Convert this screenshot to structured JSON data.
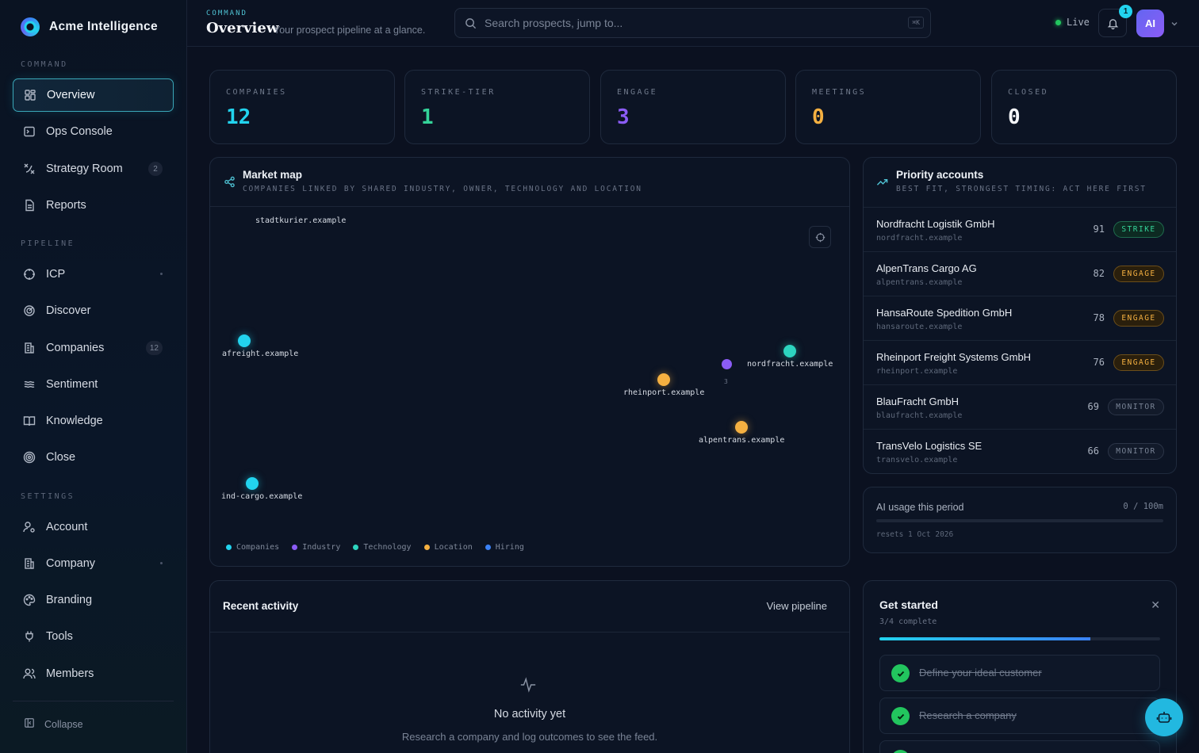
{
  "app": {
    "name": "Acme Intelligence"
  },
  "sidebar": {
    "sections": {
      "command": "COMMAND",
      "pipeline": "PIPELINE",
      "settings": "SETTINGS"
    },
    "items": [
      {
        "label": "Overview",
        "icon": "grid-icon",
        "active": true
      },
      {
        "label": "Ops Console",
        "icon": "terminal-icon"
      },
      {
        "label": "Strategy Room",
        "icon": "strategy-icon",
        "badge": "2"
      },
      {
        "label": "Reports",
        "icon": "document-icon"
      },
      {
        "label": "ICP",
        "icon": "target-icon"
      },
      {
        "label": "Discover",
        "icon": "radar-icon"
      },
      {
        "label": "Companies",
        "icon": "building-icon",
        "badge": "12"
      },
      {
        "label": "Sentiment",
        "icon": "waves-icon"
      },
      {
        "label": "Knowledge",
        "icon": "book-icon"
      },
      {
        "label": "Close",
        "icon": "bullseye-icon"
      },
      {
        "label": "Account",
        "icon": "user-gear-icon"
      },
      {
        "label": "Company",
        "icon": "building-icon"
      },
      {
        "label": "Branding",
        "icon": "palette-icon"
      },
      {
        "label": "Tools",
        "icon": "plug-icon"
      },
      {
        "label": "Members",
        "icon": "users-icon"
      }
    ],
    "collapse_label": "Collapse"
  },
  "header": {
    "crumb": "COMMAND",
    "title": "Overview",
    "subtitle": "Your prospect pipeline at a glance.",
    "search_placeholder": "Search prospects, jump to...",
    "shortcut": "⌘K",
    "live_label": "Live",
    "notification_count": "1",
    "avatar_initials": "AI"
  },
  "stats": [
    {
      "label": "COMPANIES",
      "value": "12",
      "color": "#22d3ee"
    },
    {
      "label": "STRIKE-TIER",
      "value": "1",
      "color": "#34d399"
    },
    {
      "label": "ENGAGE",
      "value": "3",
      "color": "#8b5cf6"
    },
    {
      "label": "MEETINGS",
      "value": "0",
      "color": "#f5b041"
    },
    {
      "label": "CLOSED",
      "value": "0",
      "color": "#f4f6fa"
    }
  ],
  "market_map": {
    "title": "Market map",
    "subtitle": "COMPANIES LINKED BY SHARED INDUSTRY, OWNER, TECHNOLOGY AND LOCATION",
    "nodes": [
      {
        "label": "stadtkurier.example",
        "type": "Companies"
      },
      {
        "label": "afreight.example",
        "type": "Companies"
      },
      {
        "label": "nordfracht.example",
        "type": "Technology"
      },
      {
        "label": "rheinport.example",
        "type": "Location"
      },
      {
        "label": "alpentrans.example",
        "type": "Location"
      },
      {
        "label": "ind-cargo.example",
        "type": "Companies"
      },
      {
        "label": "3",
        "type": "Industry"
      }
    ],
    "legend": [
      {
        "label": "Companies",
        "color": "#22d3ee"
      },
      {
        "label": "Industry",
        "color": "#8b5cf6"
      },
      {
        "label": "Technology",
        "color": "#2dd4bf"
      },
      {
        "label": "Location",
        "color": "#f5b041"
      },
      {
        "label": "Hiring",
        "color": "#3b82f6"
      }
    ]
  },
  "priority": {
    "title": "Priority accounts",
    "subtitle": "BEST FIT, STRONGEST TIMING: ACT HERE FIRST",
    "rows": [
      {
        "name": "Nordfracht Logistik GmbH",
        "domain": "nordfracht.example",
        "score": "91",
        "tier": "STRIKE"
      },
      {
        "name": "AlpenTrans Cargo AG",
        "domain": "alpentrans.example",
        "score": "82",
        "tier": "ENGAGE"
      },
      {
        "name": "HansaRoute Spedition GmbH",
        "domain": "hansaroute.example",
        "score": "78",
        "tier": "ENGAGE"
      },
      {
        "name": "Rheinport Freight Systems GmbH",
        "domain": "rheinport.example",
        "score": "76",
        "tier": "ENGAGE"
      },
      {
        "name": "BlauFracht GmbH",
        "domain": "blaufracht.example",
        "score": "69",
        "tier": "MONITOR"
      },
      {
        "name": "TransVelo Logistics SE",
        "domain": "transvelo.example",
        "score": "66",
        "tier": "MONITOR"
      }
    ]
  },
  "usage": {
    "label": "AI usage this period",
    "count": "0 / 100m",
    "reset": "resets 1 Oct 2026",
    "fraction": 0
  },
  "activity": {
    "title": "Recent activity",
    "link": "View pipeline",
    "empty_title": "No activity yet",
    "empty_sub": "Research a company and log outcomes to see the feed."
  },
  "get_started": {
    "title": "Get started",
    "progress": "3/4 complete",
    "fraction": 0.75,
    "tasks": [
      {
        "label": "Define your ideal customer",
        "done": true
      },
      {
        "label": "Research a company",
        "done": true
      }
    ]
  }
}
